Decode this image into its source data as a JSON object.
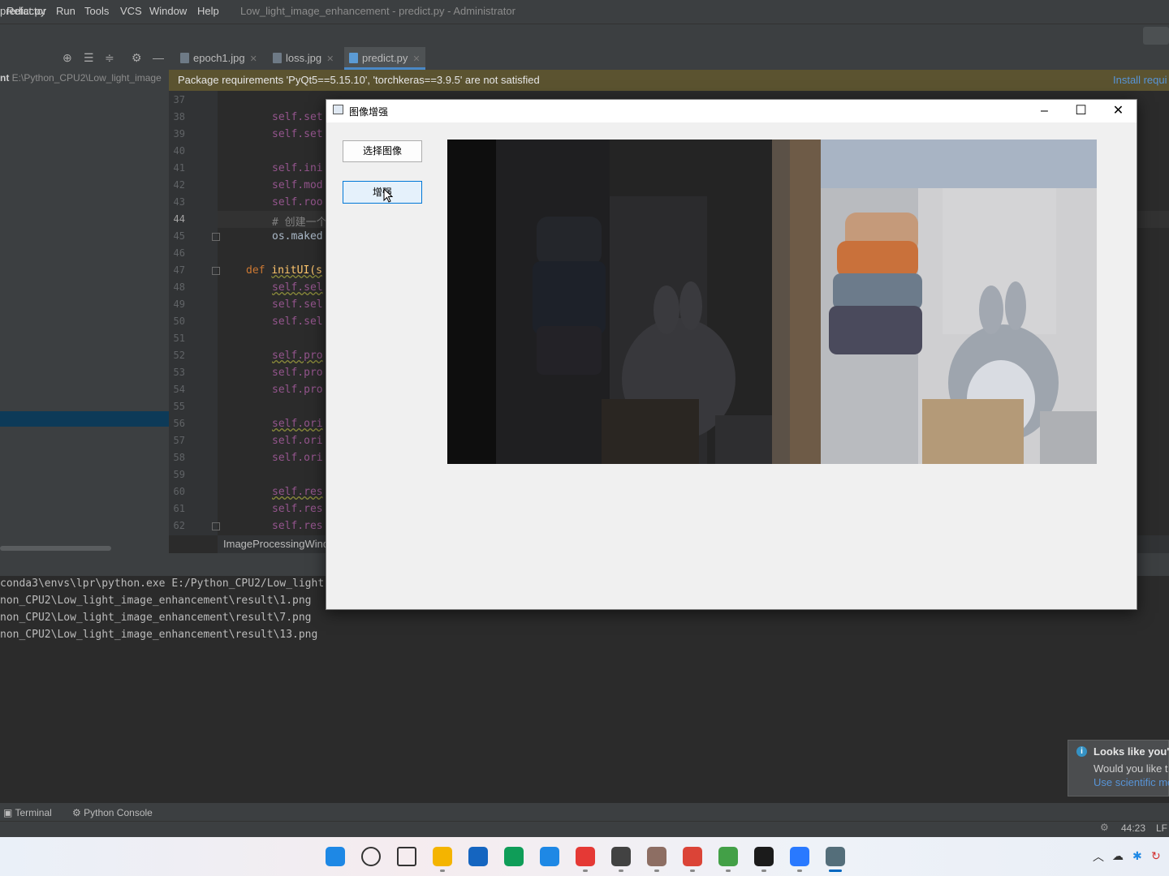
{
  "menu": {
    "items": [
      "Refactor",
      "Run",
      "Tools",
      "VCS",
      "Window",
      "Help"
    ],
    "window_title": "Low_light_image_enhancement - predict.py - Administrator"
  },
  "nav": {
    "file": "predict.py"
  },
  "project": {
    "root_label": "nt",
    "root_path": "E:\\Python_CPU2\\Low_light_image"
  },
  "tabs": [
    {
      "label": "epoch1.jpg"
    },
    {
      "label": "loss.jpg"
    },
    {
      "label": "predict.py",
      "active": true
    }
  ],
  "banner": {
    "text": "Package requirements 'PyQt5==5.15.10', 'torchkeras==3.9.5' are not satisfied",
    "link": "Install requi"
  },
  "editor": {
    "line_numbers": [
      "37",
      "38",
      "39",
      "40",
      "41",
      "42",
      "43",
      "44",
      "45",
      "46",
      "47",
      "48",
      "49",
      "50",
      "51",
      "52",
      "53",
      "54",
      "55",
      "56",
      "57",
      "58",
      "59",
      "60",
      "61",
      "62"
    ],
    "current_line": "44",
    "code": {
      "l38": "self.set",
      "l39": "self.set",
      "l41": "self.ini",
      "l42": "self.mod",
      "l43": "self.roo",
      "l44": "# 创建一个",
      "l45": "os.maked",
      "l47_def": "def",
      "l47_fn": "initUI(s",
      "l48": "self.sel",
      "l49": "self.sel",
      "l50": "self.sel",
      "l52": "self.pro",
      "l53": "self.pro",
      "l54": "self.pro",
      "l56": "self.ori",
      "l57": "self.ori",
      "l58": "self.ori",
      "l60": "self.res",
      "l61": "self.res",
      "l62": "self.res"
    },
    "breadcrumb": "ImageProcessingWind"
  },
  "run_output": [
    "conda3\\envs\\lpr\\python.exe E:/Python_CPU2/Low_light",
    "non_CPU2\\Low_light_image_enhancement\\result\\1.png",
    "non_CPU2\\Low_light_image_enhancement\\result\\7.png",
    "non_CPU2\\Low_light_image_enhancement\\result\\13.png"
  ],
  "tool_tabs": {
    "terminal": "Terminal",
    "python_console": "Python Console"
  },
  "status": {
    "position": "44:23",
    "line_sep": "LF"
  },
  "notification": {
    "title": "Looks like you'",
    "body": "Would you like t",
    "link": "Use scientific mo"
  },
  "qt_window": {
    "title": "图像增强",
    "select_button": "选择图像",
    "enhance_button": "增强",
    "minimize": "–",
    "maximize": "☐",
    "close": "✕"
  },
  "taskbar": {
    "icons": [
      "windows-start-icon",
      "search-icon",
      "task-view-icon",
      "file-explorer-icon",
      "store-icon",
      "edge-icon",
      "app-icon",
      "netease-music-icon",
      "media-icon",
      "game-icon",
      "chrome-icon",
      "wechat-icon",
      "pycharm-icon",
      "baidu-netdisk-icon",
      "active-window-icon"
    ]
  },
  "colors": {
    "ide_bg": "#2b2b2b",
    "panel_bg": "#3c3f41",
    "banner_bg": "#5b5330",
    "link": "#5894d6",
    "qt_button_focus": "#0078d7"
  }
}
